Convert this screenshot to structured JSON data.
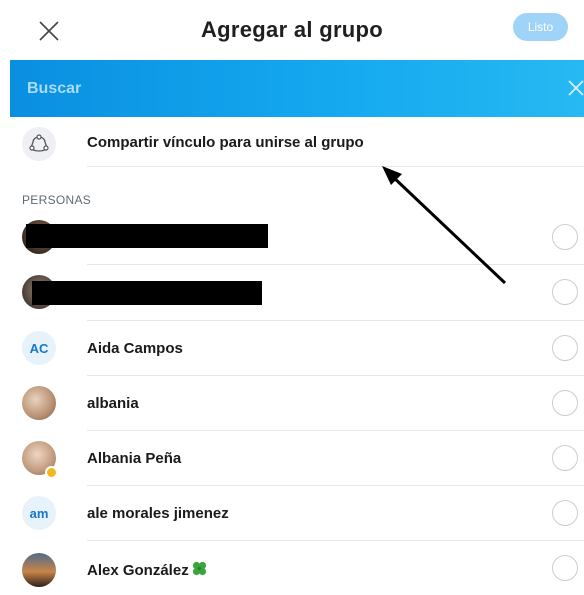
{
  "header": {
    "title": "Agregar al grupo",
    "done_label": "Listo",
    "close_icon": "close-icon"
  },
  "search": {
    "placeholder": "Buscar",
    "clear_icon": "close-icon"
  },
  "share_link": {
    "label": "Compartir vínculo para unirse al grupo",
    "icon": "share-icon"
  },
  "section": {
    "people_label": "PERSONAS"
  },
  "contacts": [
    {
      "name": "",
      "avatar": "photo",
      "redacted": true
    },
    {
      "name": "",
      "avatar": "photo",
      "redacted": true
    },
    {
      "name": "Aida Campos",
      "avatar": "initials",
      "initials": "AC"
    },
    {
      "name": "albania",
      "avatar": "photo"
    },
    {
      "name": "Albania Peña",
      "avatar": "photo",
      "status": "away"
    },
    {
      "name": "ale morales jimenez",
      "avatar": "initials",
      "initials": "am"
    },
    {
      "name": "Alex González",
      "avatar": "photo",
      "emoji": "four-leaf-clover"
    }
  ],
  "colors": {
    "accent": "#0a8fe0",
    "done_button": "#9fd3f7",
    "initials_text": "#1478c8"
  }
}
